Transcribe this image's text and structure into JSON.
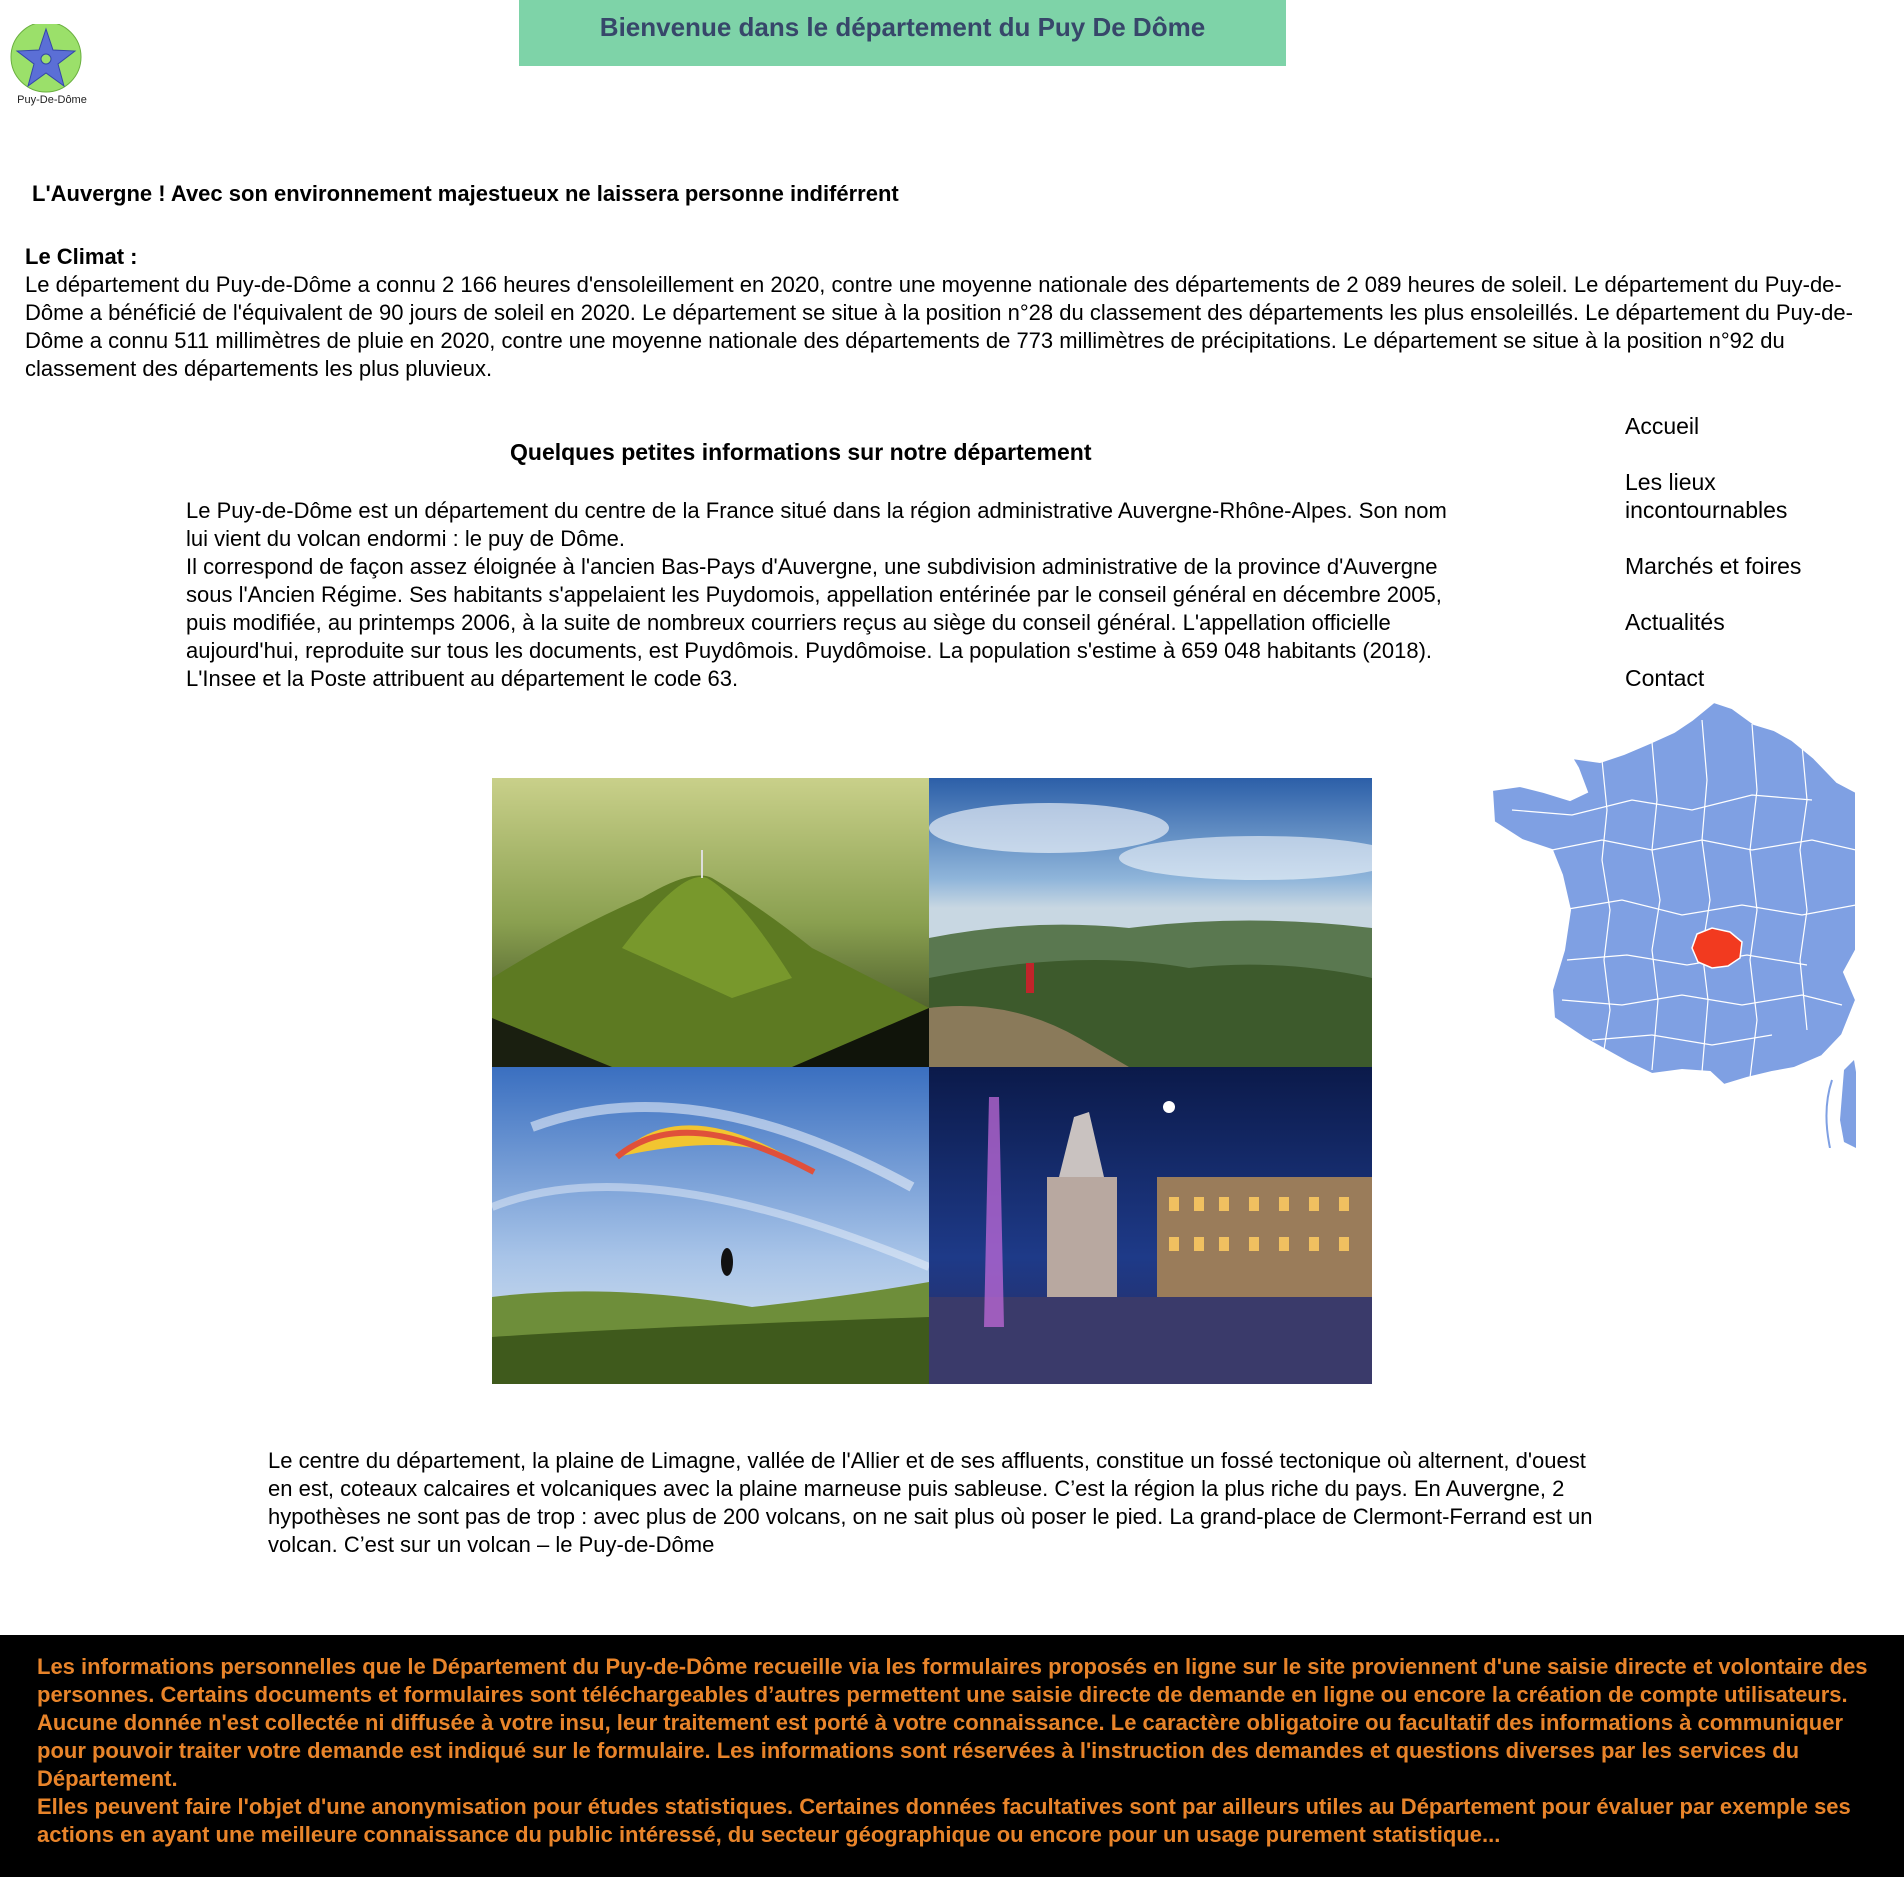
{
  "logo": {
    "caption": "Puy-De-Dôme",
    "icon": "star-icon",
    "colors": {
      "circle": "#9be06a",
      "star": "#5b6fd6"
    }
  },
  "header": {
    "title": "Bienvenue dans le département du Puy De Dôme",
    "background": "#7ed3a8",
    "title_color": "#37476a"
  },
  "tagline": "L'Auvergne ! Avec son environnement majestueux ne laissera personne indiférrent",
  "climat": {
    "title": "Le Climat :",
    "text": "Le département du Puy-de-Dôme a connu 2 166 heures d'ensoleillement en 2020, contre une moyenne nationale des départements de 2 089 heures de soleil. Le département du Puy-de-Dôme a bénéficié de l'équivalent de 90 jours de soleil en 2020. Le département se situe à la position n°28 du classement des départements les plus ensoleillés. Le département du Puy-de-Dôme a connu 511 millimètres de pluie en 2020, contre une moyenne nationale des départements de 773 millimètres de précipitations. Le département se situe à la position n°92 du classement des départements les plus pluvieux."
  },
  "nav": {
    "items": [
      {
        "label": "Accueil"
      },
      {
        "label": "Les lieux incontournables"
      },
      {
        "label": "Marchés et foires"
      },
      {
        "label": "Actualités"
      },
      {
        "label": "Contact"
      }
    ]
  },
  "info": {
    "title": "Quelques petites informations sur notre département",
    "paragraph1": "Le Puy-de-Dôme est un département du centre de la France situé dans la région administrative Auvergne-Rhône-Alpes. Son nom lui vient du volcan endormi : le puy de Dôme.",
    "paragraph2": "Il correspond de façon assez éloignée à l'ancien Bas-Pays d'Auvergne, une subdivision administrative de la province d'Auvergne sous l'Ancien Régime.  Ses habitants s'appelaient les Puydomois, appellation entérinée par le conseil général en décembre 2005, puis modifiée, au printemps 2006, à la suite de nombreux courriers reçus au siège du conseil général. L'appellation officielle aujourd'hui, reproduite sur tous les documents, est Puydômois. Puydômoise. La population s'estime à 659 048 habitants (2018). L'Insee et la Poste attribuent au département le code 63."
  },
  "map": {
    "colors": {
      "land": "#7fa0e3",
      "highlight": "#f23a1f",
      "border": "#ffffff"
    }
  },
  "photos": [
    {
      "name": "puy-de-dome-summit-photo"
    },
    {
      "name": "hiker-panorama-photo"
    },
    {
      "name": "paraglider-photo"
    },
    {
      "name": "place-de-jaude-night-photo"
    }
  ],
  "bottom_text": "Le centre du département, la plaine de Limagne, vallée de l'Allier et de ses affluents, constitue un fossé tectonique où alternent, d'ouest en est, coteaux calcaires et volcaniques avec la plaine marneuse puis sableuse. C’est la région la plus riche du pays. En Auvergne, 2 hypothèses ne sont pas de trop : avec plus de 200 volcans, on ne sait plus où poser le pied. La grand-place de Clermont-Ferrand est un volcan. C’est sur un volcan – le Puy-de-Dôme",
  "footer": {
    "paragraph1": "Les informations personnelles que le Département du Puy-de-Dôme recueille via les formulaires proposés en ligne sur le site proviennent d'une saisie directe et volontaire des personnes. Certains documents et formulaires sont téléchargeables d’autres permettent une saisie directe de demande en ligne ou encore la création de compte utilisateurs. Aucune donnée n'est collectée ni diffusée à votre insu, leur traitement est porté à votre connaissance. Le caractère obligatoire ou facultatif des informations à communiquer pour pouvoir traiter votre demande est indiqué sur le formulaire. Les informations sont réservées à l'instruction des demandes et questions diverses par les services du Département.",
    "paragraph2": "Elles peuvent faire l'objet d'une anonymisation pour études statistiques. Certaines données facultatives sont par ailleurs utiles au Département pour évaluer par exemple ses actions en ayant une meilleure connaissance du public intéressé, du secteur géographique ou encore pour un usage purement statistique...",
    "background": "#000000",
    "text_color": "#e8842a"
  }
}
